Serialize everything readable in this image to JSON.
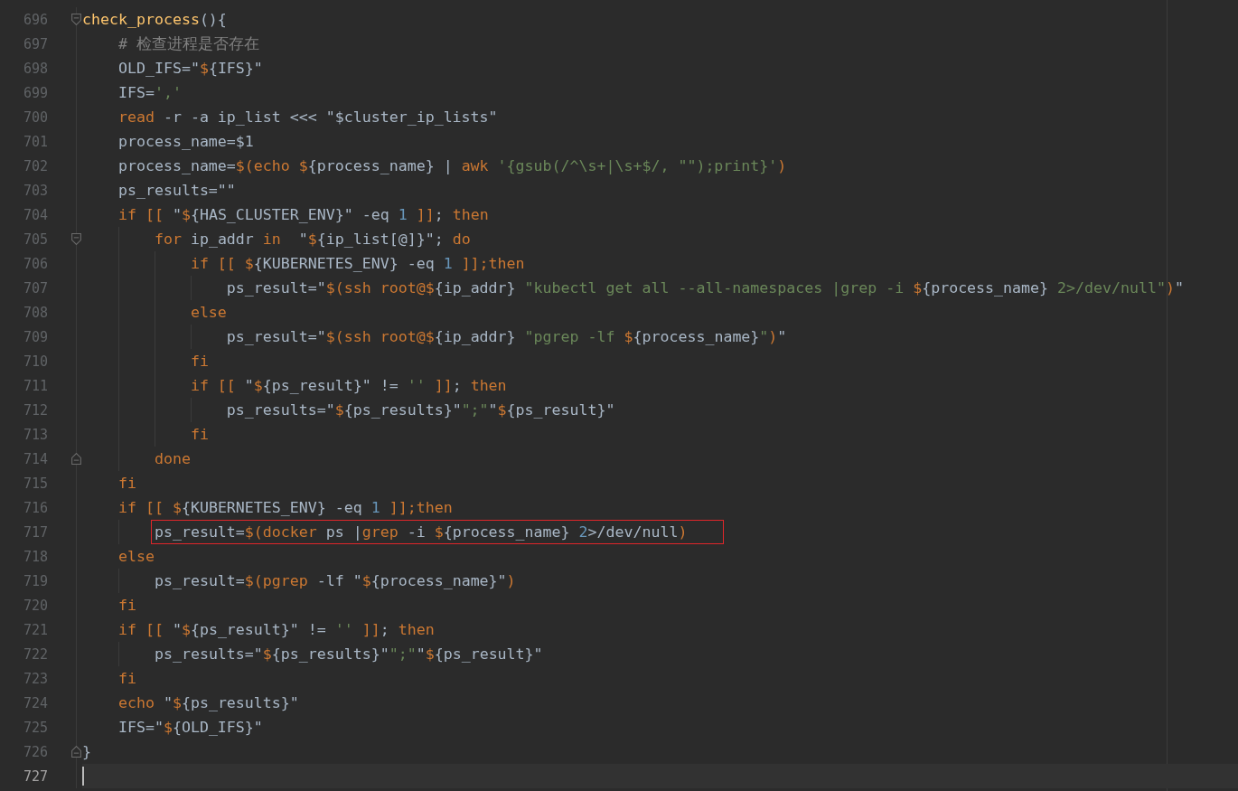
{
  "editor": {
    "lines": [
      {
        "number": "696",
        "fold": {
          "kind": "start"
        },
        "current": false,
        "highlighted": false,
        "tokens": [
          {
            "text": "check_process",
            "kind": "function"
          },
          {
            "text": "(){",
            "kind": "plain"
          }
        ]
      },
      {
        "number": "697",
        "current": false,
        "highlighted": false,
        "tokens": [
          {
            "text": "    # 检查进程是否存在",
            "kind": "comment"
          }
        ]
      },
      {
        "number": "698",
        "current": false,
        "highlighted": false,
        "tokens": [
          {
            "text": "    OLD_IFS=\"",
            "kind": "plain"
          },
          {
            "text": "$",
            "kind": "keyword"
          },
          {
            "text": "{IFS}\"",
            "kind": "plain"
          }
        ]
      },
      {
        "number": "699",
        "current": false,
        "highlighted": false,
        "tokens": [
          {
            "text": "    IFS=",
            "kind": "plain"
          },
          {
            "text": "','",
            "kind": "string"
          }
        ]
      },
      {
        "number": "700",
        "current": false,
        "highlighted": false,
        "tokens": [
          {
            "text": "    read",
            "kind": "keyword"
          },
          {
            "text": " -r -a ip_list <<< \"$cluster_ip_lists\"",
            "kind": "plain"
          }
        ]
      },
      {
        "number": "701",
        "current": false,
        "highlighted": false,
        "tokens": [
          {
            "text": "    process_name=$1",
            "kind": "plain"
          }
        ]
      },
      {
        "number": "702",
        "current": false,
        "highlighted": false,
        "tokens": [
          {
            "text": "    process_name=",
            "kind": "plain"
          },
          {
            "text": "$(echo ",
            "kind": "keyword"
          },
          {
            "text": "$",
            "kind": "keyword"
          },
          {
            "text": "{process_name} | ",
            "kind": "plain"
          },
          {
            "text": "awk",
            "kind": "keyword"
          },
          {
            "text": " '{gsub(/^\\s+|\\s+$/, \"\");print}'",
            "kind": "string"
          },
          {
            "text": ")",
            "kind": "keyword"
          }
        ]
      },
      {
        "number": "703",
        "current": false,
        "highlighted": false,
        "tokens": [
          {
            "text": "    ps_results=\"\"",
            "kind": "plain"
          }
        ]
      },
      {
        "number": "704",
        "current": false,
        "highlighted": false,
        "tokens": [
          {
            "text": "    if [[",
            "kind": "keyword"
          },
          {
            "text": " \"",
            "kind": "plain"
          },
          {
            "text": "$",
            "kind": "keyword"
          },
          {
            "text": "{HAS_CLUSTER_ENV}\" -eq ",
            "kind": "plain"
          },
          {
            "text": "1",
            "kind": "number"
          },
          {
            "text": " ]]",
            "kind": "keyword"
          },
          {
            "text": "; ",
            "kind": "plain"
          },
          {
            "text": "then",
            "kind": "keyword"
          }
        ]
      },
      {
        "number": "705",
        "fold": {
          "kind": "start"
        },
        "current": false,
        "highlighted": false,
        "tokens": [
          {
            "text": "        for",
            "kind": "keyword"
          },
          {
            "text": " ip_addr ",
            "kind": "plain"
          },
          {
            "text": "in",
            "kind": "keyword"
          },
          {
            "text": "  \"",
            "kind": "plain"
          },
          {
            "text": "$",
            "kind": "keyword"
          },
          {
            "text": "{ip_list[@]}\"; ",
            "kind": "plain"
          },
          {
            "text": "do",
            "kind": "keyword"
          }
        ]
      },
      {
        "number": "706",
        "current": false,
        "highlighted": false,
        "tokens": [
          {
            "text": "            if [[ ",
            "kind": "keyword"
          },
          {
            "text": "$",
            "kind": "keyword"
          },
          {
            "text": "{KUBERNETES_ENV} -eq ",
            "kind": "plain"
          },
          {
            "text": "1",
            "kind": "number"
          },
          {
            "text": " ]];then",
            "kind": "keyword"
          }
        ]
      },
      {
        "number": "707",
        "current": false,
        "highlighted": false,
        "tokens": [
          {
            "text": "                ps_result=\"",
            "kind": "plain"
          },
          {
            "text": "$(ssh root@",
            "kind": "keyword"
          },
          {
            "text": "$",
            "kind": "keyword"
          },
          {
            "text": "{ip_addr} ",
            "kind": "plain"
          },
          {
            "text": "\"kubectl get all --all-namespaces |grep -i ",
            "kind": "string"
          },
          {
            "text": "$",
            "kind": "keyword"
          },
          {
            "text": "{process_name}",
            "kind": "plain"
          },
          {
            "text": " 2>/dev/null\"",
            "kind": "string"
          },
          {
            "text": ")",
            "kind": "keyword"
          },
          {
            "text": "\"",
            "kind": "plain"
          }
        ]
      },
      {
        "number": "708",
        "current": false,
        "highlighted": false,
        "tokens": [
          {
            "text": "            else",
            "kind": "keyword"
          }
        ]
      },
      {
        "number": "709",
        "current": false,
        "highlighted": false,
        "tokens": [
          {
            "text": "                ps_result=\"",
            "kind": "plain"
          },
          {
            "text": "$(ssh root@",
            "kind": "keyword"
          },
          {
            "text": "$",
            "kind": "keyword"
          },
          {
            "text": "{ip_addr} ",
            "kind": "plain"
          },
          {
            "text": "\"pgrep -lf ",
            "kind": "string"
          },
          {
            "text": "$",
            "kind": "keyword"
          },
          {
            "text": "{process_name}",
            "kind": "plain"
          },
          {
            "text": "\"",
            "kind": "string"
          },
          {
            "text": ")",
            "kind": "keyword"
          },
          {
            "text": "\"",
            "kind": "plain"
          }
        ]
      },
      {
        "number": "710",
        "current": false,
        "highlighted": false,
        "tokens": [
          {
            "text": "            fi",
            "kind": "keyword"
          }
        ]
      },
      {
        "number": "711",
        "current": false,
        "highlighted": false,
        "tokens": [
          {
            "text": "            if [[",
            "kind": "keyword"
          },
          {
            "text": " \"",
            "kind": "plain"
          },
          {
            "text": "$",
            "kind": "keyword"
          },
          {
            "text": "{ps_result}\" != ",
            "kind": "plain"
          },
          {
            "text": "''",
            "kind": "string"
          },
          {
            "text": " ]]",
            "kind": "keyword"
          },
          {
            "text": "; ",
            "kind": "plain"
          },
          {
            "text": "then",
            "kind": "keyword"
          }
        ]
      },
      {
        "number": "712",
        "current": false,
        "highlighted": false,
        "tokens": [
          {
            "text": "                ps_results=\"",
            "kind": "plain"
          },
          {
            "text": "$",
            "kind": "keyword"
          },
          {
            "text": "{ps_results}\"",
            "kind": "plain"
          },
          {
            "text": "\";\"",
            "kind": "string"
          },
          {
            "text": "\"",
            "kind": "plain"
          },
          {
            "text": "$",
            "kind": "keyword"
          },
          {
            "text": "{ps_result}\"",
            "kind": "plain"
          }
        ]
      },
      {
        "number": "713",
        "current": false,
        "highlighted": false,
        "tokens": [
          {
            "text": "            fi",
            "kind": "keyword"
          }
        ]
      },
      {
        "number": "714",
        "fold": {
          "kind": "end"
        },
        "current": false,
        "highlighted": false,
        "tokens": [
          {
            "text": "        done",
            "kind": "keyword"
          }
        ]
      },
      {
        "number": "715",
        "current": false,
        "highlighted": false,
        "tokens": [
          {
            "text": "    fi",
            "kind": "keyword"
          }
        ]
      },
      {
        "number": "716",
        "current": false,
        "highlighted": false,
        "tokens": [
          {
            "text": "    if [[ ",
            "kind": "keyword"
          },
          {
            "text": "$",
            "kind": "keyword"
          },
          {
            "text": "{KUBERNETES_ENV} -eq ",
            "kind": "plain"
          },
          {
            "text": "1",
            "kind": "number"
          },
          {
            "text": " ]];then",
            "kind": "keyword"
          }
        ]
      },
      {
        "number": "717",
        "current": false,
        "highlighted": true,
        "tokens": [
          {
            "text": "        ps_result=",
            "kind": "plain"
          },
          {
            "text": "$(docker",
            "kind": "keyword"
          },
          {
            "text": " ps |",
            "kind": "plain"
          },
          {
            "text": "grep",
            "kind": "keyword"
          },
          {
            "text": " -i ",
            "kind": "plain"
          },
          {
            "text": "$",
            "kind": "keyword"
          },
          {
            "text": "{process_name} ",
            "kind": "plain"
          },
          {
            "text": "2",
            "kind": "number"
          },
          {
            "text": ">/dev/null",
            "kind": "plain"
          },
          {
            "text": ")",
            "kind": "keyword"
          }
        ]
      },
      {
        "number": "718",
        "current": false,
        "highlighted": false,
        "tokens": [
          {
            "text": "    else",
            "kind": "keyword"
          }
        ]
      },
      {
        "number": "719",
        "current": false,
        "highlighted": false,
        "tokens": [
          {
            "text": "        ps_result=",
            "kind": "plain"
          },
          {
            "text": "$(pgrep",
            "kind": "keyword"
          },
          {
            "text": " -lf \"",
            "kind": "plain"
          },
          {
            "text": "$",
            "kind": "keyword"
          },
          {
            "text": "{process_name}\"",
            "kind": "plain"
          },
          {
            "text": ")",
            "kind": "keyword"
          }
        ]
      },
      {
        "number": "720",
        "current": false,
        "highlighted": false,
        "tokens": [
          {
            "text": "    fi",
            "kind": "keyword"
          }
        ]
      },
      {
        "number": "721",
        "current": false,
        "highlighted": false,
        "tokens": [
          {
            "text": "    if [[",
            "kind": "keyword"
          },
          {
            "text": " \"",
            "kind": "plain"
          },
          {
            "text": "$",
            "kind": "keyword"
          },
          {
            "text": "{ps_result}\" != ",
            "kind": "plain"
          },
          {
            "text": "''",
            "kind": "string"
          },
          {
            "text": " ]]",
            "kind": "keyword"
          },
          {
            "text": "; ",
            "kind": "plain"
          },
          {
            "text": "then",
            "kind": "keyword"
          }
        ]
      },
      {
        "number": "722",
        "current": false,
        "highlighted": false,
        "tokens": [
          {
            "text": "        ps_results=\"",
            "kind": "plain"
          },
          {
            "text": "$",
            "kind": "keyword"
          },
          {
            "text": "{ps_results}\"",
            "kind": "plain"
          },
          {
            "text": "\";\"",
            "kind": "string"
          },
          {
            "text": "\"",
            "kind": "plain"
          },
          {
            "text": "$",
            "kind": "keyword"
          },
          {
            "text": "{ps_result}\"",
            "kind": "plain"
          }
        ]
      },
      {
        "number": "723",
        "current": false,
        "highlighted": false,
        "tokens": [
          {
            "text": "    fi",
            "kind": "keyword"
          }
        ]
      },
      {
        "number": "724",
        "current": false,
        "highlighted": false,
        "tokens": [
          {
            "text": "    echo",
            "kind": "keyword"
          },
          {
            "text": " \"",
            "kind": "plain"
          },
          {
            "text": "$",
            "kind": "keyword"
          },
          {
            "text": "{ps_results}\"",
            "kind": "plain"
          }
        ]
      },
      {
        "number": "725",
        "current": false,
        "highlighted": false,
        "tokens": [
          {
            "text": "    IFS=\"",
            "kind": "plain"
          },
          {
            "text": "$",
            "kind": "keyword"
          },
          {
            "text": "{OLD_IFS}\"",
            "kind": "plain"
          }
        ]
      },
      {
        "number": "726",
        "fold": {
          "kind": "end"
        },
        "current": false,
        "highlighted": false,
        "tokens": [
          {
            "text": "}",
            "kind": "plain"
          }
        ]
      },
      {
        "number": "727",
        "current": true,
        "highlighted": false
      }
    ]
  }
}
